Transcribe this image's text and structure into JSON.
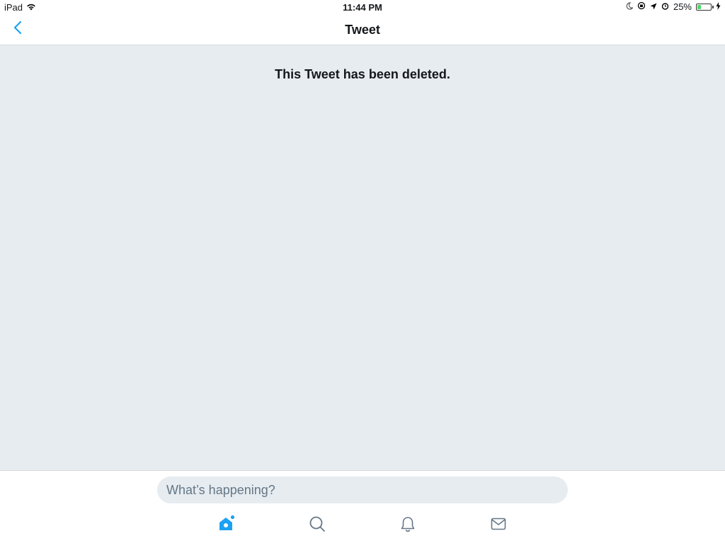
{
  "status_bar": {
    "device": "iPad",
    "time": "11:44 PM",
    "battery_text": "25%",
    "battery_level": 0.25,
    "icons": [
      "wifi-icon",
      "moon-icon",
      "rotation-lock-icon",
      "location-arrow-icon",
      "alarm-icon",
      "battery-icon",
      "charging-bolt-icon"
    ]
  },
  "nav": {
    "title": "Tweet",
    "back_icon": "chevron-left-icon"
  },
  "main": {
    "message": "This Tweet has been deleted."
  },
  "compose": {
    "placeholder": "What’s happening?"
  },
  "tabs": [
    {
      "name": "home",
      "icon": "home-icon",
      "active": true
    },
    {
      "name": "search",
      "icon": "search-icon",
      "active": false
    },
    {
      "name": "notifications",
      "icon": "bell-icon",
      "active": false
    },
    {
      "name": "messages",
      "icon": "envelope-icon",
      "active": false
    }
  ],
  "colors": {
    "accent": "#1da1f2",
    "background": "#e6ecf0",
    "icon_inactive": "#657786",
    "text": "#14171a",
    "battery_fill": "#4cd964"
  }
}
